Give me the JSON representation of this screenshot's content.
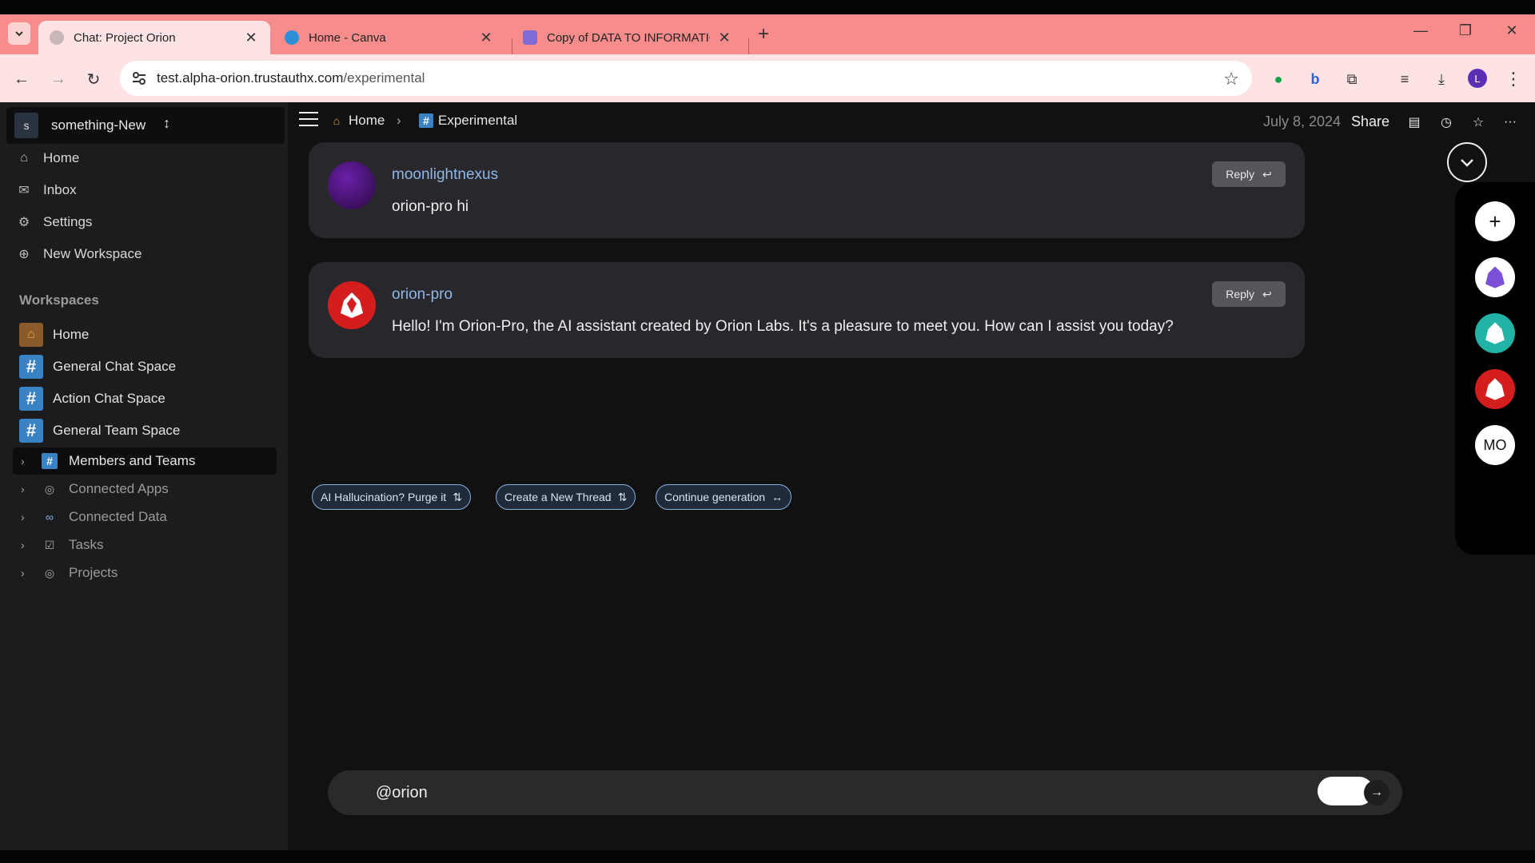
{
  "browser": {
    "tabs": [
      {
        "title": "Chat: Project Orion",
        "active": true
      },
      {
        "title": "Home - Canva",
        "active": false
      },
      {
        "title": "Copy of DATA TO INFORMATIO",
        "active": false
      }
    ],
    "url_host": "test.alpha-orion.trustauthx.com",
    "url_path": "/experimental",
    "profile_initial": "L"
  },
  "sidebar": {
    "workspace_avatar": "s",
    "workspace_name": "something-New",
    "links": [
      {
        "label": "Home",
        "icon": "home-icon"
      },
      {
        "label": "Inbox",
        "icon": "inbox-icon"
      },
      {
        "label": "Settings",
        "icon": "gear-icon"
      },
      {
        "label": "New Workspace",
        "icon": "plus-circle-icon"
      }
    ],
    "section_title": "Workspaces",
    "workspaces": [
      {
        "label": "Home",
        "icon": "home-icon"
      },
      {
        "label": "General Chat Space",
        "icon": "hash-icon"
      },
      {
        "label": "Action Chat Space",
        "icon": "hash-icon"
      },
      {
        "label": "General Team Space",
        "icon": "hash-icon"
      }
    ],
    "tree": [
      {
        "label": "Members and Teams",
        "icon": "hash-icon",
        "active": true
      },
      {
        "label": "Connected Apps",
        "icon": "apps-icon",
        "active": false
      },
      {
        "label": "Connected Data",
        "icon": "link-icon",
        "active": false
      },
      {
        "label": "Tasks",
        "icon": "checkbox-icon",
        "active": false
      },
      {
        "label": "Projects",
        "icon": "projects-icon",
        "active": false
      }
    ]
  },
  "header": {
    "crumb_home": "Home",
    "crumb_current": "Experimental",
    "date": "July 8, 2024",
    "share_label": "Share"
  },
  "messages": [
    {
      "author": "moonlightnexus",
      "text": "orion-pro hi",
      "reply_label": "Reply"
    },
    {
      "author": "orion-pro",
      "text": "Hello! I'm Orion-Pro, the AI assistant created by Orion Labs. It's a pleasure to meet you. How can I assist you today?",
      "reply_label": "Reply"
    }
  ],
  "actions": [
    {
      "label": "AI Hallucination? Purge it"
    },
    {
      "label": "Create a New Thread"
    },
    {
      "label": "Continue generation"
    }
  ],
  "composer": {
    "value": "@orion"
  },
  "rail": {
    "user_initials": "MO"
  },
  "colors": {
    "tab_strip": "#f68c8c",
    "accent_link": "#8fb7e8",
    "hash_blue": "#3b82c4"
  }
}
